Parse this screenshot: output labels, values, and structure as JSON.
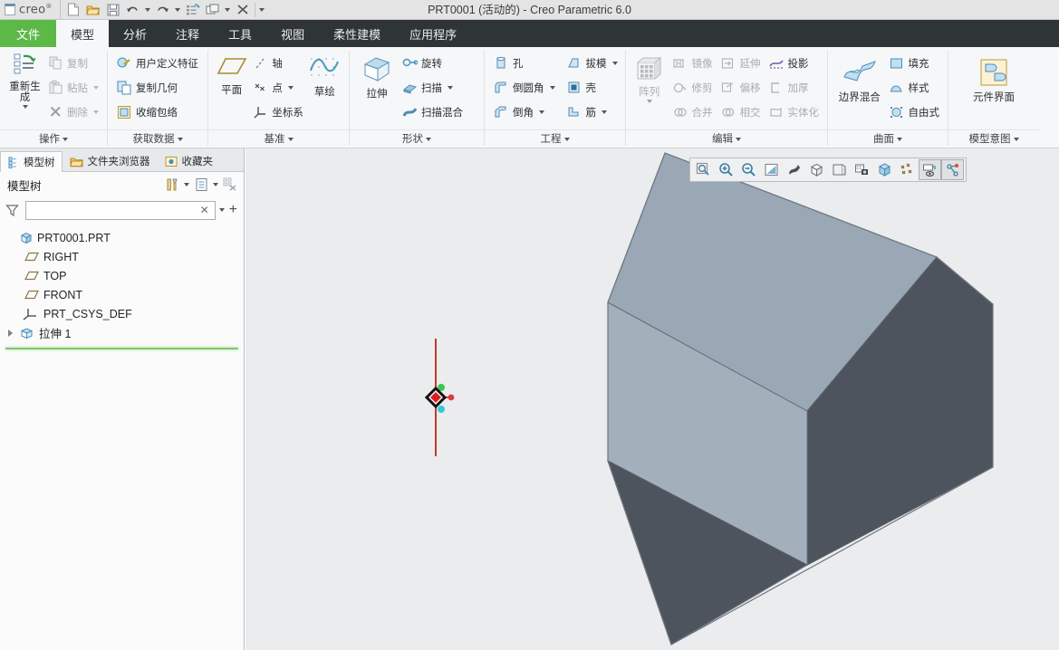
{
  "window": {
    "title": "PRT0001 (活动的) - Creo Parametric 6.0",
    "logo_text": "creo",
    "logo_sup": "®"
  },
  "quick_access": [
    {
      "name": "new-file",
      "tip": "新建"
    },
    {
      "name": "open-file",
      "tip": "打开"
    },
    {
      "name": "save-file",
      "tip": "保存"
    },
    {
      "name": "undo",
      "tip": "撤消"
    },
    {
      "name": "redo",
      "tip": "重做"
    },
    {
      "name": "regenerate",
      "tip": "重新生成"
    },
    {
      "name": "switch-window",
      "tip": "窗口"
    },
    {
      "name": "close-window",
      "tip": "关闭"
    }
  ],
  "tabs": [
    {
      "label": "文件",
      "kind": "file"
    },
    {
      "label": "模型",
      "kind": "active"
    },
    {
      "label": "分析",
      "kind": "normal"
    },
    {
      "label": "注释",
      "kind": "normal"
    },
    {
      "label": "工具",
      "kind": "normal"
    },
    {
      "label": "视图",
      "kind": "normal"
    },
    {
      "label": "柔性建模",
      "kind": "normal"
    },
    {
      "label": "应用程序",
      "kind": "normal"
    }
  ],
  "ribbon": {
    "groups": [
      {
        "label": "操作",
        "big": {
          "label": "重新生成",
          "icon": "regenerate-icon",
          "disabled": false,
          "has_caret": true
        },
        "items": [
          {
            "label": "复制",
            "icon": "copy-icon",
            "disabled": true,
            "caret": false
          },
          {
            "label": "粘贴",
            "icon": "paste-icon",
            "disabled": true,
            "caret": true
          },
          {
            "label": "删除",
            "icon": "delete-icon",
            "disabled": true,
            "caret": true
          }
        ]
      },
      {
        "label": "获取数据",
        "items": [
          {
            "label": "用户定义特征",
            "icon": "udf-icon",
            "disabled": false,
            "caret": false
          },
          {
            "label": "复制几何",
            "icon": "copy-geometry-icon",
            "disabled": false,
            "caret": false
          },
          {
            "label": "收缩包络",
            "icon": "shrinkwrap-icon",
            "disabled": false,
            "caret": false
          }
        ]
      },
      {
        "label": "基准",
        "big": {
          "label": "平面",
          "icon": "datum-plane-icon",
          "disabled": false,
          "has_caret": false
        },
        "items": [
          {
            "label": "轴",
            "icon": "datum-axis-icon",
            "disabled": false,
            "caret": false
          },
          {
            "label": "点",
            "icon": "datum-point-icon",
            "disabled": false,
            "caret": true
          },
          {
            "label": "坐标系",
            "icon": "datum-csys-icon",
            "disabled": false,
            "caret": false
          }
        ],
        "big2": {
          "label": "草绘",
          "icon": "sketch-icon",
          "disabled": false,
          "has_caret": false
        }
      },
      {
        "label": "形状",
        "big": {
          "label": "拉伸",
          "icon": "extrude-icon",
          "disabled": false,
          "has_caret": false
        },
        "items": [
          {
            "label": "旋转",
            "icon": "revolve-icon",
            "disabled": false,
            "caret": false
          },
          {
            "label": "扫描",
            "icon": "sweep-icon",
            "disabled": false,
            "caret": true
          },
          {
            "label": "扫描混合",
            "icon": "swept-blend-icon",
            "disabled": false,
            "caret": false
          }
        ]
      },
      {
        "label": "工程",
        "items_left": [
          {
            "label": "孔",
            "icon": "hole-icon",
            "disabled": false,
            "caret": false
          },
          {
            "label": "倒圆角",
            "icon": "round-icon",
            "disabled": false,
            "caret": true
          },
          {
            "label": "倒角",
            "icon": "chamfer-icon",
            "disabled": false,
            "caret": true
          }
        ],
        "items_right": [
          {
            "label": "拔模",
            "icon": "draft-icon",
            "disabled": false,
            "caret": true
          },
          {
            "label": "壳",
            "icon": "shell-icon",
            "disabled": false,
            "caret": false
          },
          {
            "label": "筋",
            "icon": "rib-icon",
            "disabled": false,
            "caret": true
          }
        ]
      },
      {
        "label": "编辑",
        "big": {
          "label": "阵列",
          "icon": "pattern-icon",
          "disabled": true,
          "has_caret": true
        },
        "items_left": [
          {
            "label": "镜像",
            "icon": "mirror-icon",
            "disabled": true,
            "caret": false
          },
          {
            "label": "修剪",
            "icon": "trim-icon",
            "disabled": true,
            "caret": false
          },
          {
            "label": "合并",
            "icon": "merge-icon",
            "disabled": true,
            "caret": false
          }
        ],
        "items_mid": [
          {
            "label": "延伸",
            "icon": "extend-icon",
            "disabled": true,
            "caret": false
          },
          {
            "label": "偏移",
            "icon": "offset-icon",
            "disabled": true,
            "caret": false
          },
          {
            "label": "相交",
            "icon": "intersect-icon",
            "disabled": true,
            "caret": false
          }
        ],
        "items_right": [
          {
            "label": "投影",
            "icon": "project-icon",
            "disabled": false,
            "caret": false
          },
          {
            "label": "加厚",
            "icon": "thicken-icon",
            "disabled": true,
            "caret": false
          },
          {
            "label": "实体化",
            "icon": "solidify-icon",
            "disabled": true,
            "caret": false
          }
        ]
      },
      {
        "label": "曲面",
        "big": {
          "label": "边界混合",
          "icon": "boundary-blend-icon",
          "disabled": false,
          "has_caret": false
        },
        "items": [
          {
            "label": "填充",
            "icon": "fill-icon",
            "disabled": false,
            "caret": false
          },
          {
            "label": "样式",
            "icon": "style-icon",
            "disabled": false,
            "caret": false
          },
          {
            "label": "自由式",
            "icon": "freestyle-icon",
            "disabled": false,
            "caret": false
          }
        ]
      },
      {
        "label": "模型意图",
        "big": {
          "label": "元件界面",
          "icon": "component-interface-icon",
          "disabled": false,
          "has_caret": false
        }
      }
    ]
  },
  "left_panel": {
    "tabs": [
      {
        "label": "模型树",
        "icon": "model-tree-icon",
        "active": true
      },
      {
        "label": "文件夹浏览器",
        "icon": "folder-browser-icon",
        "active": false
      },
      {
        "label": "收藏夹",
        "icon": "favorites-icon",
        "active": false
      }
    ],
    "header_title": "模型树",
    "header_icons": [
      "tree-tools-icon",
      "tree-settings-icon",
      "tree-filter-off-icon"
    ],
    "search": {
      "value": "",
      "placeholder": "",
      "filter_icon": "funnel-icon",
      "clear_label": "✕",
      "add_label": "+"
    },
    "tree": [
      {
        "label": "PRT0001.PRT",
        "icon": "part-icon",
        "indent": 0,
        "expandable": false
      },
      {
        "label": "RIGHT",
        "icon": "datum-plane-icon",
        "indent": 1,
        "expandable": false
      },
      {
        "label": "TOP",
        "icon": "datum-plane-icon",
        "indent": 1,
        "expandable": false
      },
      {
        "label": "FRONT",
        "icon": "datum-plane-icon",
        "indent": 1,
        "expandable": false
      },
      {
        "label": "PRT_CSYS_DEF",
        "icon": "datum-csys-icon",
        "indent": 1,
        "expandable": false
      },
      {
        "label": "拉伸 1",
        "icon": "extrude-feature-icon",
        "indent": 0,
        "expandable": true
      }
    ],
    "insert_indicator": "在此插入"
  },
  "graphics": {
    "toolbar": [
      {
        "name": "zoom-fit-icon",
        "pressed": false
      },
      {
        "name": "zoom-in-icon",
        "pressed": false
      },
      {
        "name": "zoom-out-icon",
        "pressed": false
      },
      {
        "name": "repaint-icon",
        "pressed": false
      },
      {
        "name": "spin-center-icon",
        "pressed": false
      },
      {
        "name": "display-style-icon",
        "pressed": false
      },
      {
        "name": "saved-orientations-icon",
        "pressed": false
      },
      {
        "name": "scene-icon",
        "pressed": false
      },
      {
        "name": "perspective-view-icon",
        "pressed": false
      },
      {
        "name": "datum-display-icon",
        "pressed": false
      },
      {
        "name": "annotation-display-icon",
        "pressed": true
      },
      {
        "name": "spin-center-toggle-icon",
        "pressed": true
      }
    ],
    "background_color": "#ebecee",
    "model": {
      "name": "extruded-box",
      "top_face_color": "#9aa7b4",
      "left_face_color": "#a3b0bb",
      "front_face_color": "#4e545e",
      "edge_color": "#6e7680",
      "spin_center": {
        "marker_color": "#d91f1f",
        "axis_color": "#c0392b",
        "x_dot_color": "#e03a3a",
        "y_dot_color": "#3fc44f",
        "z_dot_color": "#35c8d6"
      }
    }
  }
}
